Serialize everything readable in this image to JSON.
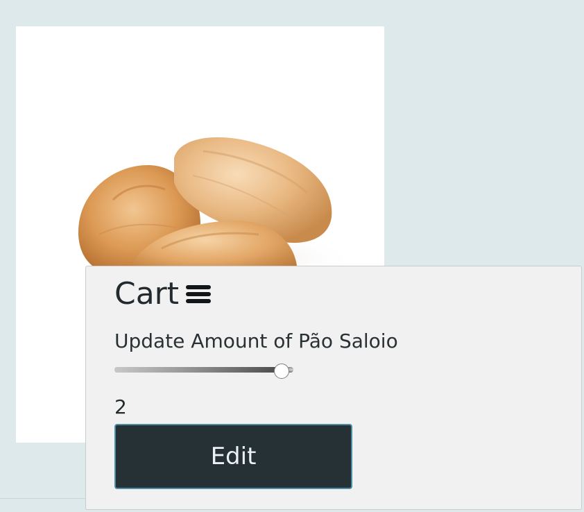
{
  "product": {
    "image_alt": "Pão Saloio bread rolls"
  },
  "cart": {
    "title": "Cart",
    "menu_icon": "hamburger-menu-icon",
    "update_label": "Update Amount of Pão Saloio",
    "slider": {
      "min": 0,
      "max": 2,
      "value": 2
    },
    "amount_value": "2",
    "edit_label": "Edit"
  },
  "colors": {
    "page_background": "#dee9eb",
    "panel_background": "#f1f1f1",
    "button_background": "#263136",
    "button_border": "#4a8fa3"
  }
}
